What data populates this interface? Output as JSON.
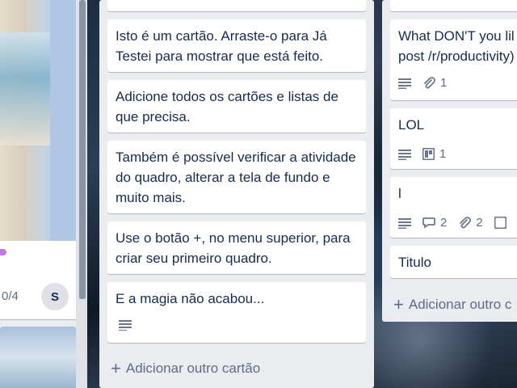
{
  "left_list": {
    "card_counter": "0/4",
    "avatar_initial": "S",
    "label_color": "#c377e0"
  },
  "middle_list": {
    "cards": [
      {
        "text": "Isto é um cartão. Arraste-o para Já Testei para mostrar que está feito."
      },
      {
        "text": "Adicione todos os cartões e listas de que precisa."
      },
      {
        "text": "Também é possível verificar a atividade do quadro, alterar a tela de fundo e muito mais."
      },
      {
        "text": "Use o botão +, no menu superior, para criar seu primeiro quadro."
      },
      {
        "text": "E a magia não acabou..."
      }
    ],
    "add_card_label": "Adicionar outro cartão"
  },
  "right_list": {
    "cards": [
      {
        "text": "What DON'T you lil post /r/productivity)",
        "attachments": "1"
      },
      {
        "text": "LOL",
        "checklist": "1"
      },
      {
        "text": "l",
        "comments": "2",
        "attachments": "2"
      },
      {
        "text": "Titulo"
      }
    ],
    "add_card_label": "Adicionar outro c"
  },
  "icons": {
    "description": "description-icon",
    "attachment": "paperclip-icon",
    "checklist": "board-icon",
    "comment": "comment-icon",
    "plus": "plus-icon"
  }
}
